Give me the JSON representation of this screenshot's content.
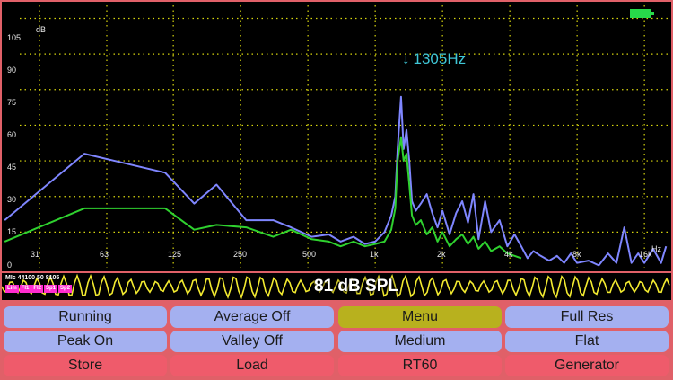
{
  "spectrum": {
    "y_unit": "dB",
    "y_ticks": [
      "105",
      "90",
      "75",
      "60",
      "45",
      "30",
      "15",
      "0"
    ],
    "x_unit": "Hz",
    "x_ticks": [
      "31",
      "63",
      "125",
      "250",
      "500",
      "1k",
      "2k",
      "4k",
      "8k",
      "16k"
    ],
    "peak_arrow": "↓",
    "peak_label": "1305Hz",
    "colors": {
      "peak_trace": "#7f86ff",
      "live_trace": "#2fd12f",
      "grid": "#d8d60e",
      "peak_label": "#3fc6d6"
    }
  },
  "chart_data": {
    "type": "line",
    "x_scale": "log",
    "xlabel": "Hz",
    "ylabel": "dB",
    "ylim": [
      0,
      112
    ],
    "series": [
      {
        "x": [
          22,
          50,
          115,
          155,
          195,
          265,
          350,
          420,
          520,
          620,
          700,
          800,
          900,
          1000,
          1100,
          1180,
          1230,
          1260,
          1305,
          1340,
          1380,
          1420,
          1460,
          1520,
          1600,
          1700,
          1800,
          1900,
          2000,
          2150,
          2300,
          2450,
          2600,
          2750,
          2900,
          3100,
          3300,
          3600,
          3900,
          4200,
          4500,
          4800,
          5100,
          5500,
          6000,
          6500,
          7000,
          7500,
          8000,
          9000,
          10000,
          11000,
          12000,
          13000,
          14000,
          15000,
          16000,
          17500,
          19000,
          20000
        ],
        "values": [
          20,
          48,
          40,
          27,
          35,
          20,
          20,
          17,
          13,
          14,
          11,
          13,
          10,
          11,
          15,
          22,
          30,
          50,
          72,
          50,
          58,
          45,
          28,
          24,
          27,
          31,
          23,
          17,
          24,
          14,
          23,
          28,
          19,
          31,
          12,
          28,
          15,
          20,
          9,
          14,
          9,
          4,
          7,
          5,
          3,
          5,
          2,
          6,
          2,
          3,
          1,
          6,
          2,
          17,
          2,
          6,
          2,
          8,
          2,
          9
        ]
      },
      {
        "x": [
          22,
          50,
          115,
          155,
          195,
          265,
          350,
          420,
          520,
          620,
          700,
          800,
          900,
          1000,
          1100,
          1180,
          1230,
          1260,
          1305,
          1340,
          1380,
          1420,
          1460,
          1520,
          1600,
          1700,
          1800,
          1900,
          2000,
          2150,
          2300,
          2450,
          2600,
          2750,
          2900,
          3100,
          3300,
          3600,
          3900,
          4200,
          4500
        ],
        "values": [
          11,
          25,
          25,
          16,
          18,
          17,
          13,
          16,
          12,
          11,
          9,
          11,
          9,
          10,
          11,
          16,
          25,
          45,
          55,
          45,
          48,
          35,
          22,
          18,
          20,
          14,
          17,
          11,
          15,
          9,
          12,
          14,
          10,
          13,
          8,
          11,
          7,
          9,
          6,
          5,
          4
        ]
      }
    ]
  },
  "strip": {
    "info": "MIc 44100 50 8105",
    "tags": [
      "Lim",
      "Fl1",
      "Fl2",
      "Sp1",
      "Sp2"
    ],
    "level_value": "81",
    "level_unit": "dB SPL"
  },
  "buttons": {
    "running": "Running",
    "average": "Average Off",
    "menu": "Menu",
    "fullres": "Full Res",
    "peak": "Peak On",
    "valley": "Valley Off",
    "medium": "Medium",
    "flat": "Flat",
    "store": "Store",
    "load": "Load",
    "rt60": "RT60",
    "generator": "Generator"
  }
}
